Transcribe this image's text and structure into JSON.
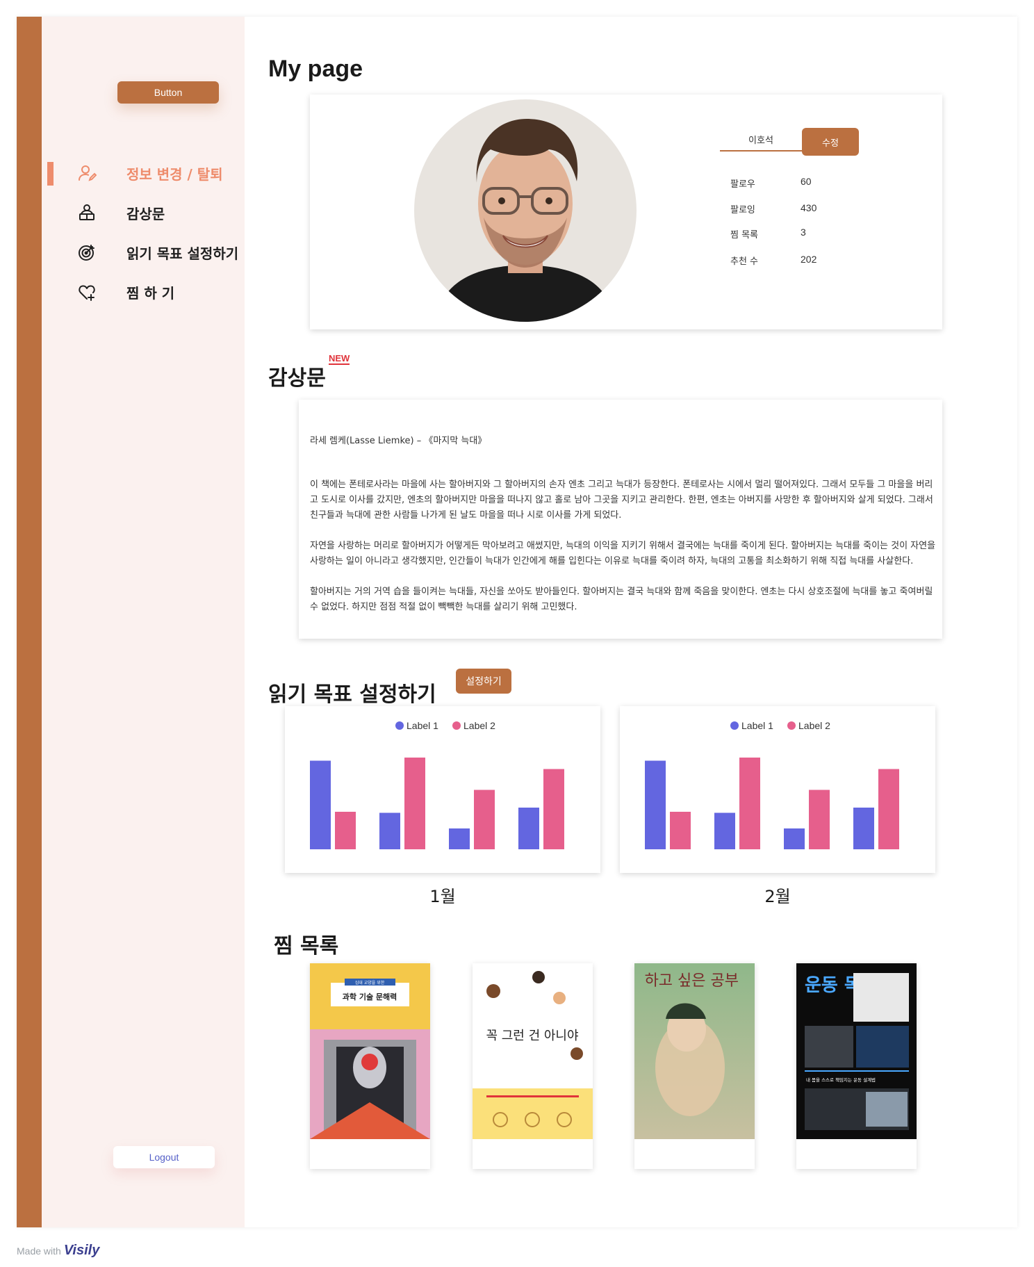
{
  "sidebar": {
    "top_button": "Button",
    "items": [
      {
        "label": "정보 변경 / 탈퇴",
        "icon": "user-edit-icon"
      },
      {
        "label": "감상문",
        "icon": "reader-icon"
      },
      {
        "label": "읽기 목표 설정하기",
        "icon": "target-icon"
      },
      {
        "label": "찜 하 기",
        "icon": "heart-plus-icon"
      }
    ],
    "logout": "Logout"
  },
  "page": {
    "title": "My page"
  },
  "profile": {
    "name": "이호석",
    "edit": "수정",
    "stats": [
      {
        "label": "팔로우",
        "value": "60"
      },
      {
        "label": "팔로잉",
        "value": "430"
      },
      {
        "label": "찜 목록",
        "value": "3"
      },
      {
        "label": "추천 수",
        "value": "202"
      }
    ]
  },
  "review": {
    "title": "감상문",
    "badge": "NEW",
    "author": "라세 렘케(Lasse Liemke) – 《마지막 늑대》",
    "paragraphs": [
      "이 책에는 폰테로사라는 마을에 사는 할아버지와 그 할아버지의 손자 엔초 그리고 늑대가 등장한다. 폰테로사는 시에서 멀리 떨어져있다. 그래서 모두들 그 마을을 버리고 도시로 이사를 갔지만, 엔초의 할아버지만 마을을 떠나지 않고 홀로 남아 그곳을 지키고 관리한다. 한편, 엔초는 아버지를 사망한 후 할아버지와 살게 되었다. 그래서 친구들과 늑대에 관한 사람들 나가게 된 날도 마을을 떠나 시로 이사를 가게 되었다.",
      "자연을 사랑하는 머리로 할아버지가 어떻게든 막아보려고 애썼지만, 늑대의 이익을 지키기 위해서 결국에는 늑대를 죽이게 된다. 할아버지는 늑대를 죽이는 것이 자연을 사랑하는 일이 아니라고 생각했지만, 인간들이 늑대가 인간에게 해를 입힌다는 이유로 늑대를 죽이려 하자, 늑대의 고통을 최소화하기 위해 직접 늑대를 사살한다.",
      "할아버지는 거의 거역 습을 들이켜는 늑대들, 자신을 쏘아도 받아들인다. 할아버지는 결국 늑대와 함께 죽음을 맞이한다. 엔초는 다시 상호조절에 늑대를 놓고 죽여버릴 수 없었다. 하지만 점점 적절 없이 빽빽한 늑대를 살리기 위해 고민했다."
    ]
  },
  "goals": {
    "title": "읽기 목표 설정하기",
    "button": "설정하기"
  },
  "chart_data": [
    {
      "type": "bar",
      "title": "",
      "caption": "1월",
      "categories": [
        "",
        "",
        "",
        ""
      ],
      "series": [
        {
          "name": "Label 1",
          "color": "#6366e0",
          "values": [
            85,
            35,
            20,
            40
          ]
        },
        {
          "name": "Label 2",
          "color": "#e65f8c",
          "values": [
            36,
            88,
            57,
            77
          ]
        }
      ],
      "ylim": [
        0,
        100
      ],
      "legend": "top-center",
      "grid": false
    },
    {
      "type": "bar",
      "title": "",
      "caption": "2월",
      "categories": [
        "",
        "",
        "",
        ""
      ],
      "series": [
        {
          "name": "Label 1",
          "color": "#6366e0",
          "values": [
            85,
            35,
            20,
            40
          ]
        },
        {
          "name": "Label 2",
          "color": "#e65f8c",
          "values": [
            36,
            88,
            57,
            77
          ]
        }
      ],
      "ylim": [
        0,
        100
      ],
      "legend": "top-center",
      "grid": false
    }
  ],
  "wishlist": {
    "title": "찜 목록",
    "books": [
      {
        "cover_title": "과학 기술 문해력",
        "cover_subtitle": "십대 교양을 위한"
      },
      {
        "cover_title": "꼭 그런 건 아니야",
        "cover_subtitle": ""
      },
      {
        "cover_title": "하고 싶은 공부",
        "cover_subtitle": ""
      },
      {
        "cover_title": "운동 독립",
        "cover_subtitle": "내 몸을 스스로 책임지는 운동 설계법"
      }
    ]
  },
  "footer": {
    "made_with": "Made with",
    "brand": "Visily"
  },
  "colors": {
    "accent": "#bb7040",
    "nav_active": "#ee8c6c",
    "sidebar_bg": "#fbf1ef",
    "series1": "#6366e0",
    "series2": "#e65f8c"
  }
}
